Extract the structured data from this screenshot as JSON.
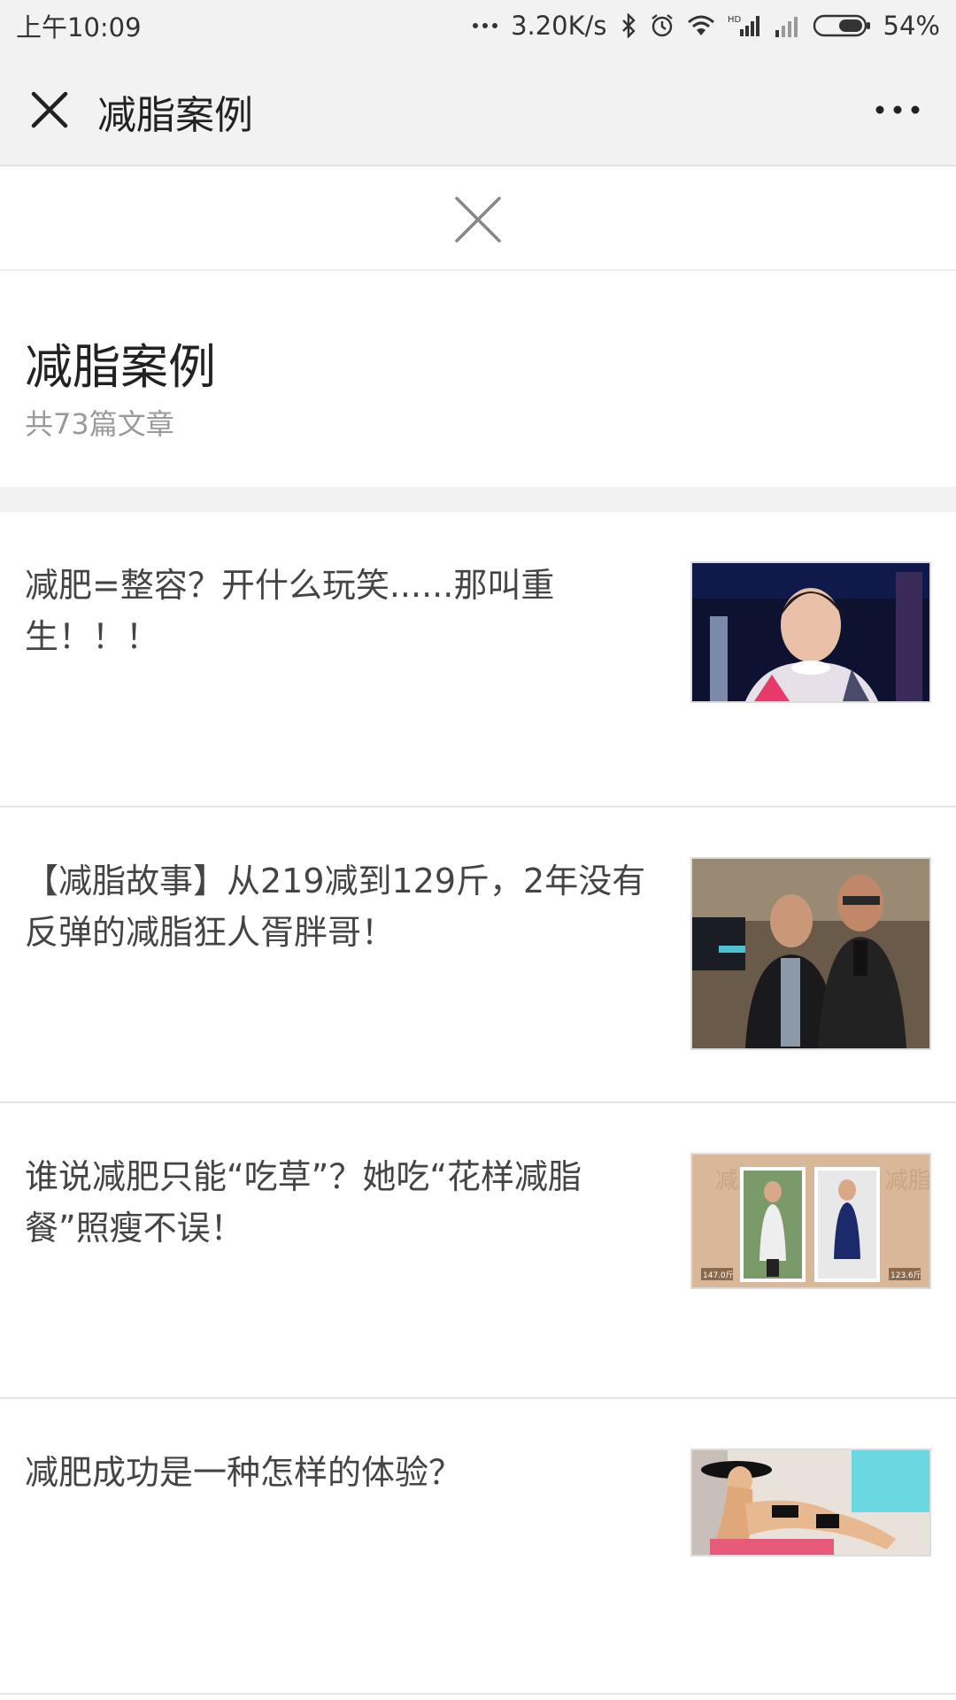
{
  "status_bar": {
    "time": "上午10:09",
    "network_speed": "3.20K/s",
    "battery": "54%",
    "icons": [
      "dots-icon",
      "bluetooth-icon",
      "alarm-icon",
      "wifi-icon",
      "hd-signal-icon",
      "signal-icon",
      "battery-icon"
    ]
  },
  "title_bar": {
    "title": "减脂案例",
    "close_icon": "close-icon",
    "more_icon": "more-icon"
  },
  "collapse": {
    "icon": "close-icon"
  },
  "collection": {
    "title": "减脂案例",
    "count_text": "共73篇文章"
  },
  "articles": [
    {
      "title": "减肥=整容？开什么玩笑......那叫重生！！！",
      "thumbnail": "woman-on-stage-photo"
    },
    {
      "title": "【减脂故事】从219减到129斤，2年没有反弹的减脂狂人胥胖哥！",
      "thumbnail": "two-men-photo"
    },
    {
      "title": "谁说减肥只能“吃草”？她吃“花样减脂餐”照瘦不误！",
      "thumbnail": "before-after-photo",
      "thumb_labels": {
        "left": "减脂前",
        "right": "减脂后",
        "left_weight": "147.0斤",
        "right_weight": "123.6斤"
      }
    },
    {
      "title": "减肥成功是一种怎样的体验？",
      "thumbnail": "poolside-woman-photo"
    }
  ],
  "colors": {
    "bar_bg": "#f2f2f2",
    "text": "#444444",
    "muted": "#9a9a9a"
  }
}
